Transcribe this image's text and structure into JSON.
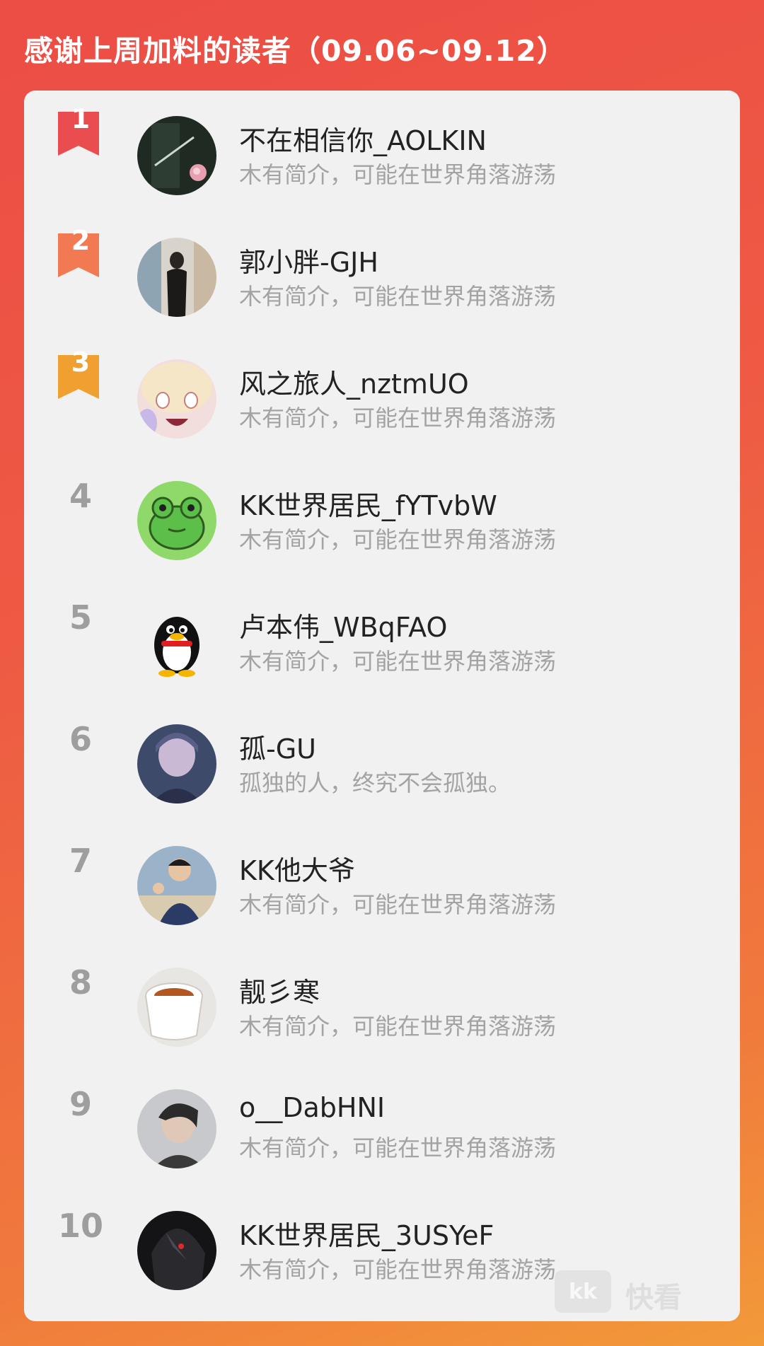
{
  "header": {
    "title": "感谢上周加料的读者（09.06~09.12）"
  },
  "colors": {
    "rank1": "#ea4d4f",
    "rank2": "#f27a52",
    "rank3": "#f0a030",
    "rank_other": "#9e9e9e"
  },
  "readers": [
    {
      "rank": "1",
      "name": "不在相信你_AOLKIN",
      "bio": "木有简介，可能在世界角落游荡"
    },
    {
      "rank": "2",
      "name": "郭小胖-GJH",
      "bio": "木有简介，可能在世界角落游荡"
    },
    {
      "rank": "3",
      "name": "风之旅人_nztmUO",
      "bio": "木有简介，可能在世界角落游荡"
    },
    {
      "rank": "4",
      "name": "KK世界居民_fYTvbW",
      "bio": "木有简介，可能在世界角落游荡"
    },
    {
      "rank": "5",
      "name": "卢本伟_WBqFAO",
      "bio": "木有简介，可能在世界角落游荡"
    },
    {
      "rank": "6",
      "name": "孤-GU",
      "bio": "孤独的人，终究不会孤独。"
    },
    {
      "rank": "7",
      "name": "KK他大爷",
      "bio": "木有简介，可能在世界角落游荡"
    },
    {
      "rank": "8",
      "name": "靓彡寒",
      "bio": "木有简介，可能在世界角落游荡"
    },
    {
      "rank": "9",
      "name": "o__DabHNI",
      "bio": "木有简介，可能在世界角落游荡"
    },
    {
      "rank": "10",
      "name": "KK世界居民_3USYeF",
      "bio": "木有简介，可能在世界角落游荡"
    }
  ],
  "watermark": {
    "logo": "kk",
    "text": "快看"
  }
}
